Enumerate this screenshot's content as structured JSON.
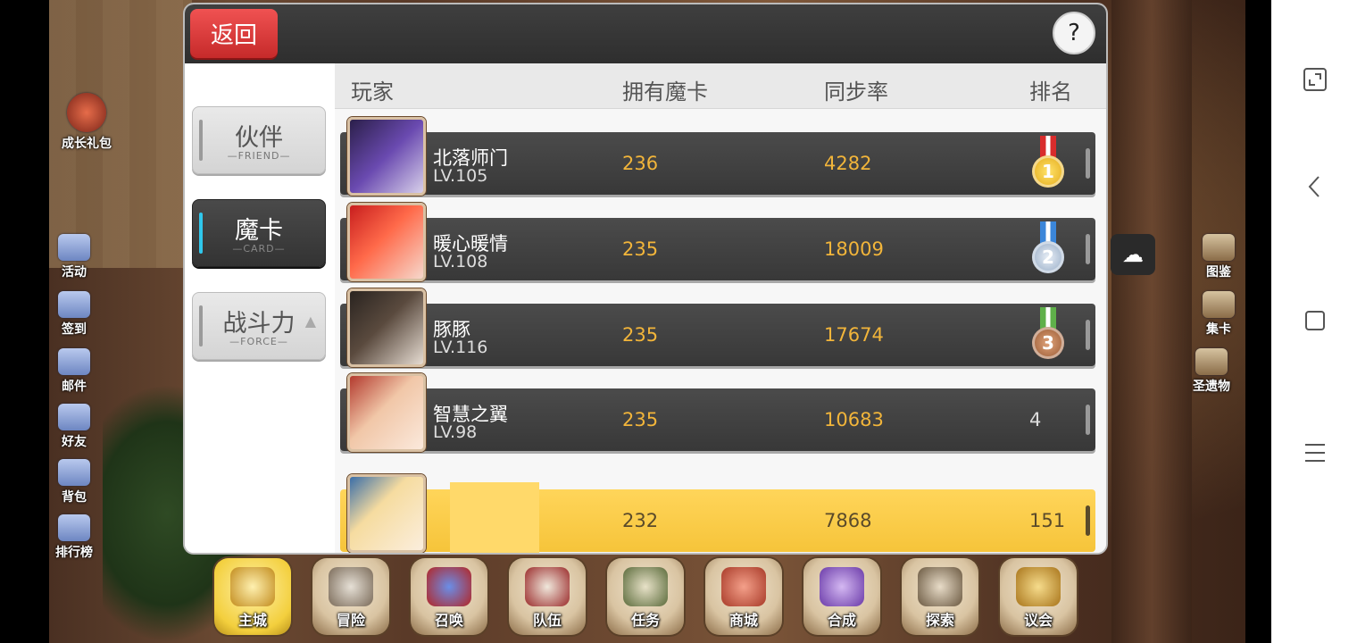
{
  "header": {
    "back_label": "返回",
    "help_label": "?"
  },
  "tabs": [
    {
      "label": "伙伴",
      "sub": "FRIEND",
      "active": false
    },
    {
      "label": "魔卡",
      "sub": "CARD",
      "active": true
    },
    {
      "label": "战斗力",
      "sub": "FORCE",
      "active": false
    }
  ],
  "sort_indicator": "▲",
  "columns": {
    "player": "玩家",
    "cards": "拥有魔卡",
    "sync": "同步率",
    "rank": "排名"
  },
  "rows": [
    {
      "name": "北落师门",
      "level": "LV.105",
      "cards": "236",
      "sync": "4282",
      "rank": "1",
      "medal": "gold"
    },
    {
      "name": "暖心暖情",
      "level": "LV.108",
      "cards": "235",
      "sync": "18009",
      "rank": "2",
      "medal": "silver"
    },
    {
      "name": "豚豚",
      "level": "LV.116",
      "cards": "235",
      "sync": "17674",
      "rank": "3",
      "medal": "bronze"
    },
    {
      "name": "智慧之翼",
      "level": "LV.98",
      "cards": "235",
      "sync": "10683",
      "rank": "4",
      "medal": ""
    }
  ],
  "self_row": {
    "cards": "232",
    "sync": "7868",
    "rank": "151"
  },
  "left_menu": [
    "成长礼包",
    "活动",
    "签到",
    "邮件",
    "好友",
    "背包",
    "排行榜"
  ],
  "right_menu": [
    "图鉴",
    "集卡",
    "圣遗物"
  ],
  "bottom_nav": [
    "主城",
    "冒险",
    "召唤",
    "队伍",
    "任务",
    "商城",
    "合成",
    "探索",
    "议会"
  ],
  "colors": {
    "accent_gold": "#f2b53a",
    "back_red": "#e53e3e",
    "active_tab_bar": "#2fc7ec",
    "self_highlight": "#ffd55a"
  },
  "system_nav_icons": [
    "fullscreen-icon",
    "back-icon",
    "home-icon",
    "menu-icon"
  ]
}
